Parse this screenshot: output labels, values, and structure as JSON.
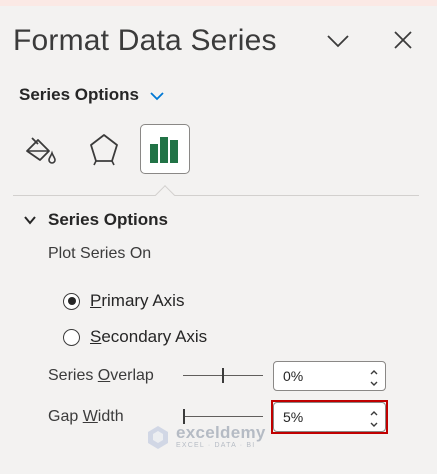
{
  "pane": {
    "title": "Format Data Series"
  },
  "series_dropdown": {
    "label": "Series Options"
  },
  "tabs": [
    {
      "icon": "paint-bucket-icon",
      "active": false
    },
    {
      "icon": "pentagon-icon",
      "active": false
    },
    {
      "icon": "bar-chart-icon",
      "active": true
    }
  ],
  "section": {
    "header": "Series Options",
    "plot_series_on": "Plot Series On",
    "radios": [
      {
        "prefix": "P",
        "rest": "rimary Axis",
        "checked": true
      },
      {
        "prefix": "S",
        "rest": "econdary Axis",
        "checked": false
      }
    ],
    "overlap": {
      "label_before": "Series ",
      "label_underline": "O",
      "label_after": "verlap",
      "value": "0%",
      "slider_level": 0.5
    },
    "gap_width": {
      "label_before": "Gap ",
      "label_underline": "W",
      "label_after": "idth",
      "value": "5%",
      "slider_level": 0.0
    }
  },
  "watermark": {
    "name": "exceldemy",
    "tagline": "EXCEL · DATA · BI"
  },
  "colors": {
    "accent": "#0078d4",
    "icon_green": "#217346",
    "highlight": "#c00000"
  }
}
